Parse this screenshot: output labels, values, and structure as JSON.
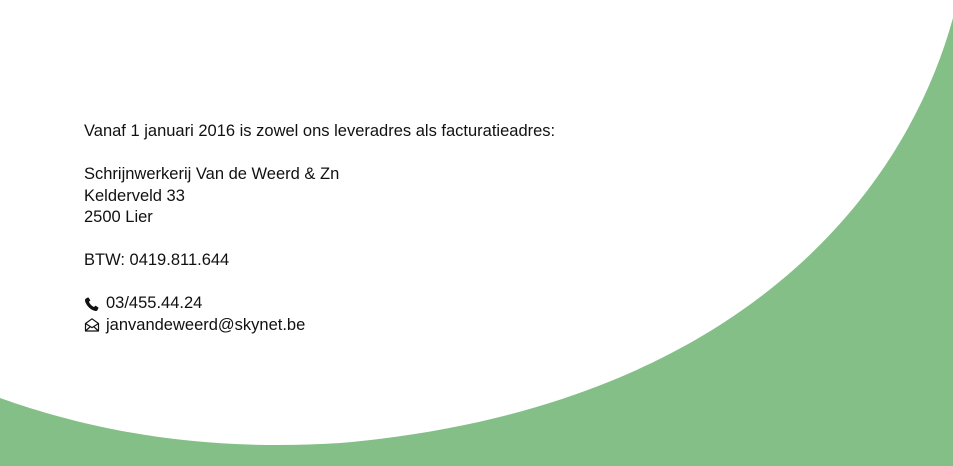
{
  "notice": {
    "intro": "Vanaf 1 januari 2016 is zowel ons leveradres als facturatieadres:"
  },
  "address": {
    "company": "Schrijnwerkerij Van de Weerd & Zn",
    "street": "Kelderveld 33",
    "city": "2500 Lier"
  },
  "vat": {
    "text": "BTW: 0419.811.644"
  },
  "contact": {
    "phone": "03/455.44.24",
    "phone_icon": "phone-icon",
    "email": "janvandeweerd@skynet.be",
    "email_icon": "envelope-icon"
  },
  "colors": {
    "accent": "#84bf88",
    "background": "#ffffff",
    "text": "#111111"
  }
}
